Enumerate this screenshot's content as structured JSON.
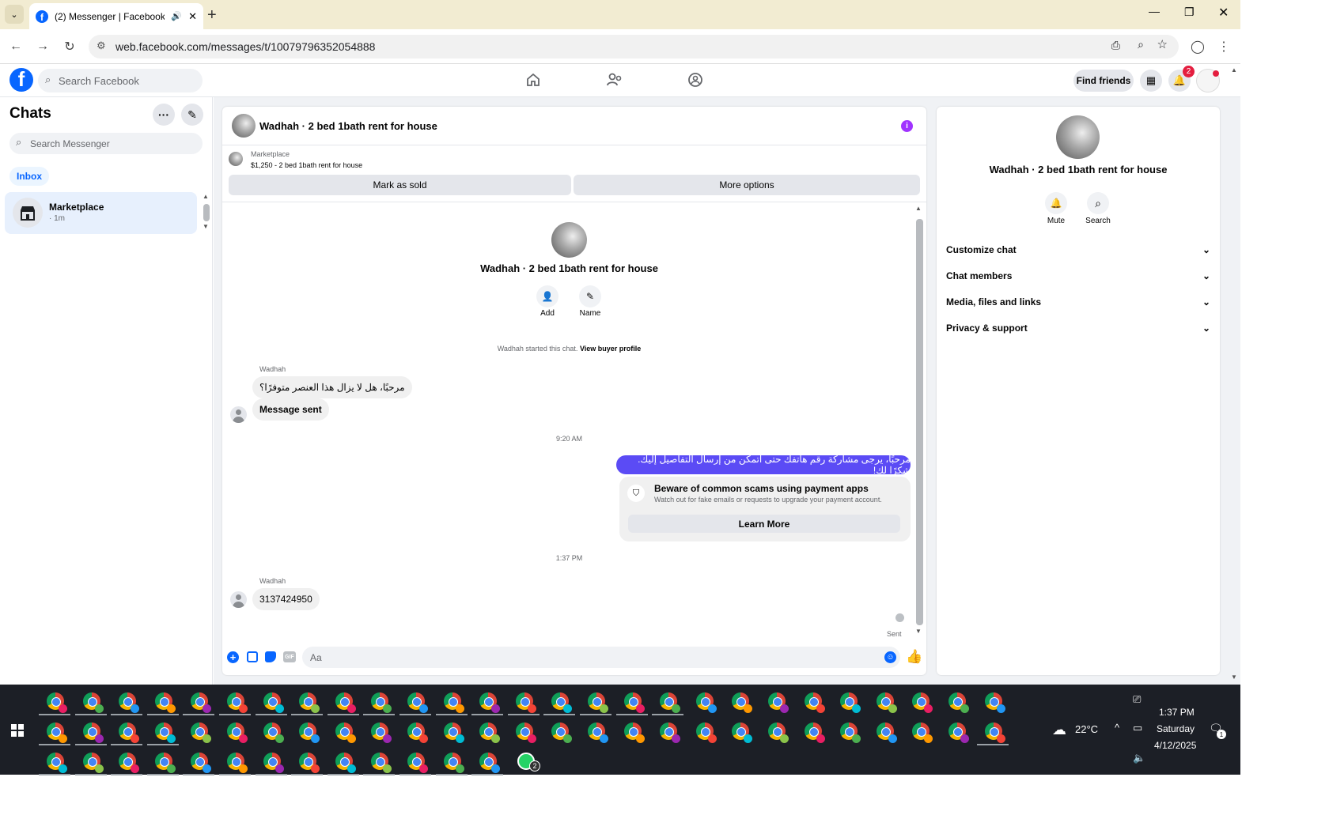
{
  "browser": {
    "tab_title": "(2) Messenger | Facebook",
    "url": "web.facebook.com/messages/t/10079796352054888"
  },
  "fb": {
    "search_placeholder": "Search Facebook",
    "find_friends": "Find friends",
    "notif_count": "2"
  },
  "chats": {
    "title": "Chats",
    "search_placeholder": "Search Messenger",
    "inbox_label": "Inbox",
    "items": [
      {
        "name": "Marketplace",
        "meta": "· 1m"
      }
    ]
  },
  "conversation": {
    "title": "Wadhah · 2 bed 1bath rent for house",
    "listing_source": "Marketplace",
    "listing_title": "$1,250 - 2 bed 1bath rent for house",
    "mark_sold": "Mark as sold",
    "more_options": "More options",
    "profile_name": "Wadhah · 2 bed 1bath rent for house",
    "add_label": "Add",
    "name_label": "Name",
    "started_text": "Wadhah started this chat.",
    "view_buyer": "View buyer profile",
    "messages": [
      {
        "sender": "Wadhah",
        "text": "مرحبًا، هل لا يزال هذا العنصر متوفرًا؟"
      },
      {
        "sender": "",
        "text": "Message sent"
      },
      {
        "timestamp": "9:20 AM"
      },
      {
        "sender": "me",
        "text": "مرحبًا، يرجى مشاركة رقم هاتفك حتى أتمكن من إرسال التفاصيل إليك. شكرًا لك!"
      },
      {
        "timestamp": "1:37 PM"
      },
      {
        "sender": "Wadhah",
        "text": "3137424950"
      }
    ],
    "scam_title": "Beware of common scams using payment apps",
    "scam_body": "Watch out for fake emails or requests to upgrade your payment account.",
    "learn_more": "Learn More",
    "sent_status": "Sent",
    "composer_placeholder": "Aa",
    "gif_label": "GIF"
  },
  "details": {
    "name": "Wadhah · 2 bed 1bath rent for house",
    "mute": "Mute",
    "search": "Search",
    "sections": [
      "Customize chat",
      "Chat members",
      "Media, files and links",
      "Privacy & support"
    ]
  },
  "taskbar": {
    "temperature": "22°C",
    "time": "1:37 PM",
    "day": "Saturday",
    "date": "4/12/2025",
    "whatsapp_badge": "2",
    "notif_badge": "1"
  },
  "colors": {
    "fb_blue": "#0866ff",
    "msg_purple": "#5b4bf5",
    "taskbar": "#1c1f26"
  }
}
